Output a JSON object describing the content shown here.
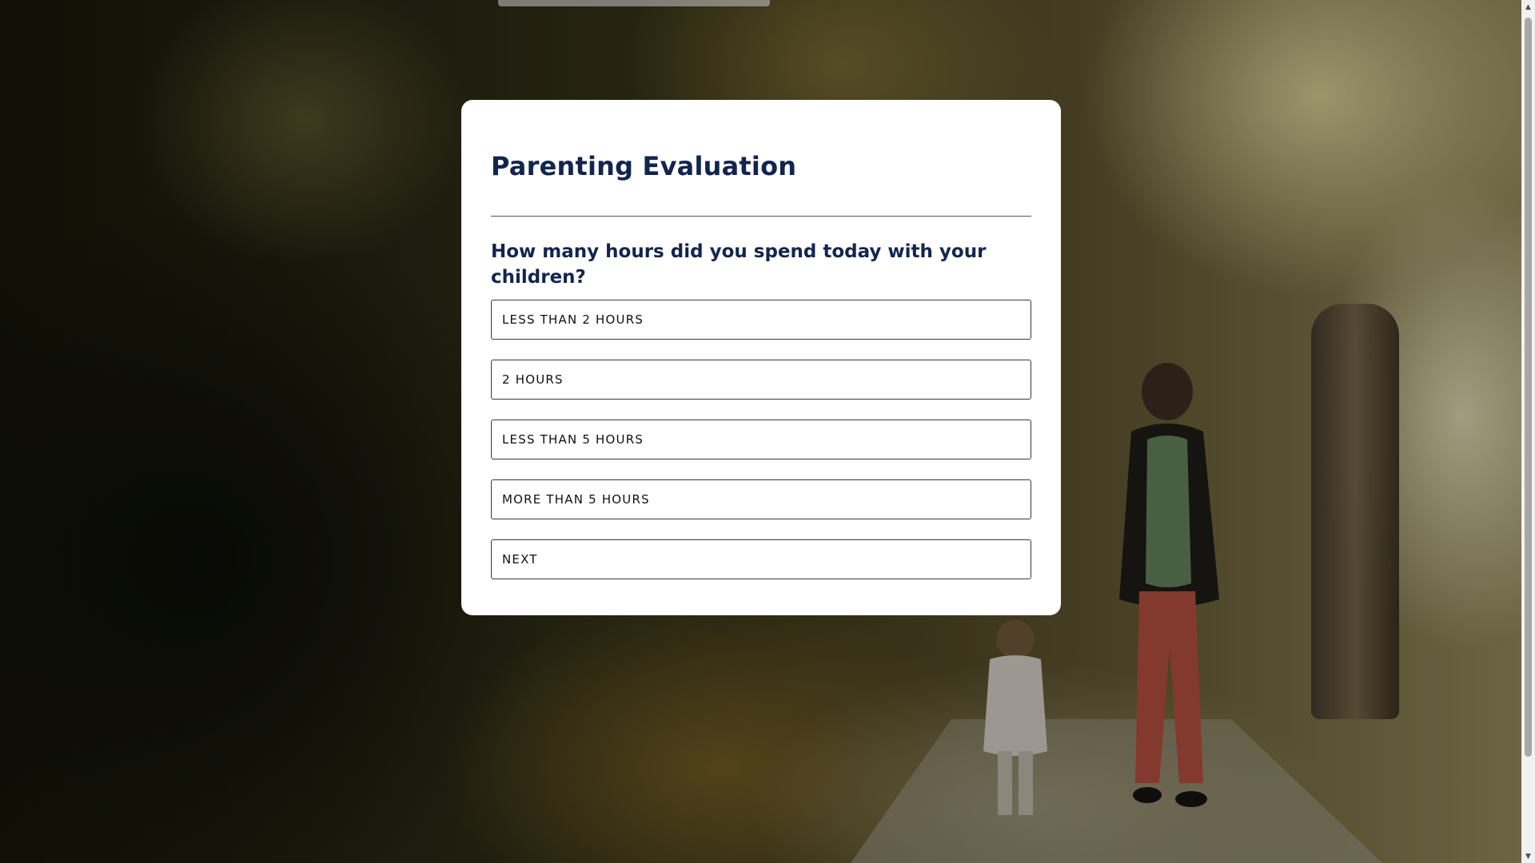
{
  "quiz": {
    "title": "Parenting Evaluation",
    "question": "How many hours did you spend today with your children?",
    "options": [
      {
        "label": "LESS THAN 2 HOURS"
      },
      {
        "label": "2 HOURS"
      },
      {
        "label": "LESS THAN 5 HOURS"
      },
      {
        "label": "MORE THAN 5 HOURS"
      }
    ],
    "next_label": "NEXT"
  },
  "theme": {
    "title_color": "#12254d",
    "card_background": "#ffffff",
    "option_border": "#3a3a3a"
  },
  "background": {
    "description_icon": "photo-background"
  },
  "scrollbar": {
    "up_icon": "chevron-up-icon",
    "down_icon": "chevron-down-icon"
  }
}
